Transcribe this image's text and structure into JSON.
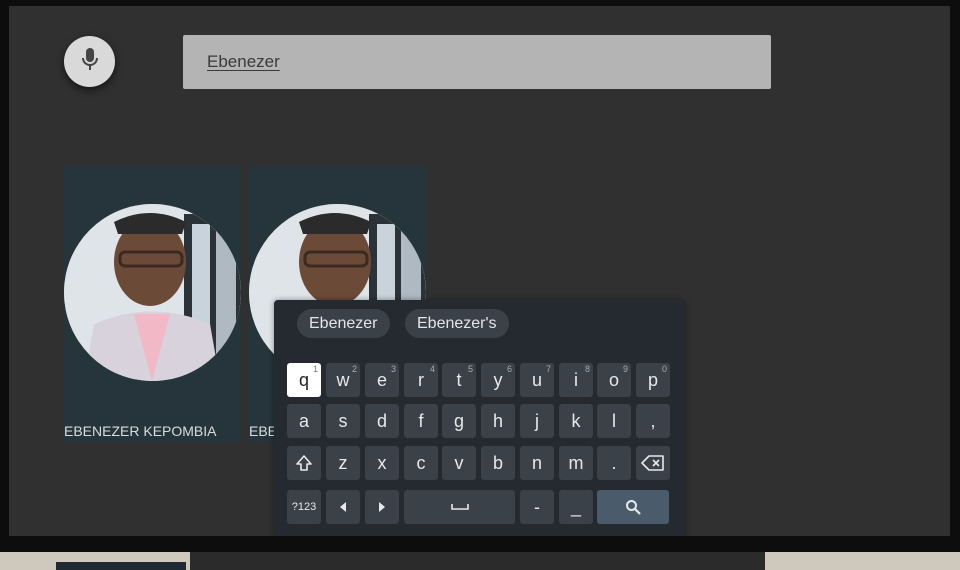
{
  "search": {
    "query": "Ebenezer"
  },
  "icons": {
    "mic": "microphone-icon",
    "shift": "shift-icon",
    "backspace": "backspace-icon",
    "left": "arrow-left-icon",
    "right": "arrow-right-icon",
    "space": "space-icon",
    "search": "search-icon"
  },
  "results": [
    {
      "name": "EBENEZER KEPOMBIA"
    },
    {
      "name": "EBE"
    }
  ],
  "keyboard": {
    "suggestions": [
      "Ebenezer",
      "Ebenezer's"
    ],
    "row1": [
      {
        "label": "q",
        "hint": "1"
      },
      {
        "label": "w",
        "hint": "2"
      },
      {
        "label": "e",
        "hint": "3"
      },
      {
        "label": "r",
        "hint": "4"
      },
      {
        "label": "t",
        "hint": "5"
      },
      {
        "label": "y",
        "hint": "6"
      },
      {
        "label": "u",
        "hint": "7"
      },
      {
        "label": "i",
        "hint": "8"
      },
      {
        "label": "o",
        "hint": "9"
      },
      {
        "label": "p",
        "hint": "0"
      }
    ],
    "row2": [
      "a",
      "s",
      "d",
      "f",
      "g",
      "h",
      "j",
      "k",
      "l",
      ","
    ],
    "row3": [
      "z",
      "x",
      "c",
      "v",
      "b",
      "n",
      "m",
      "."
    ],
    "row4": {
      "symbols": "?123",
      "dash": "-",
      "underscore": "_"
    },
    "focused_key": "q"
  },
  "colors": {
    "background": "#303030",
    "keyboard": "#242a30",
    "key": "#3a4148",
    "search_key": "#4a5c6b",
    "card": "#26343b"
  }
}
